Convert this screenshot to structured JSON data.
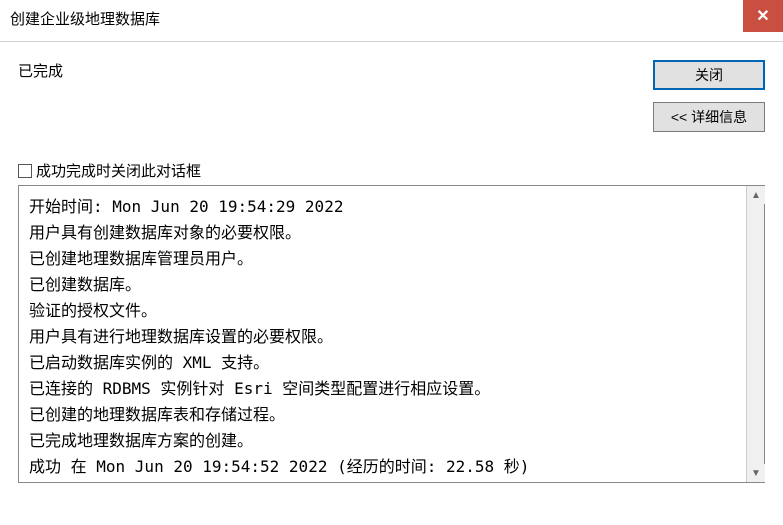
{
  "window": {
    "title": "创建企业级地理数据库"
  },
  "status": {
    "text": "已完成"
  },
  "buttons": {
    "close_label": "关闭",
    "details_label": "<< 详细信息"
  },
  "checkbox": {
    "label": "成功完成时关闭此对话框",
    "checked": false
  },
  "log": {
    "lines": [
      "开始时间: Mon Jun 20 19:54:29 2022",
      "用户具有创建数据库对象的必要权限。",
      "已创建地理数据库管理员用户。",
      "已创建数据库。",
      "验证的授权文件。",
      "用户具有进行地理数据库设置的必要权限。",
      "已启动数据库实例的 XML 支持。",
      "已连接的 RDBMS 实例针对 Esri 空间类型配置进行相应设置。",
      "已创建的地理数据库表和存储过程。",
      "已完成地理数据库方案的创建。",
      "成功 在 Mon Jun 20 19:54:52 2022 (经历的时间: 22.58 秒)"
    ]
  },
  "scroll": {
    "up_glyph": "▲",
    "down_glyph": "▼"
  },
  "close_x_glyph": "✕"
}
